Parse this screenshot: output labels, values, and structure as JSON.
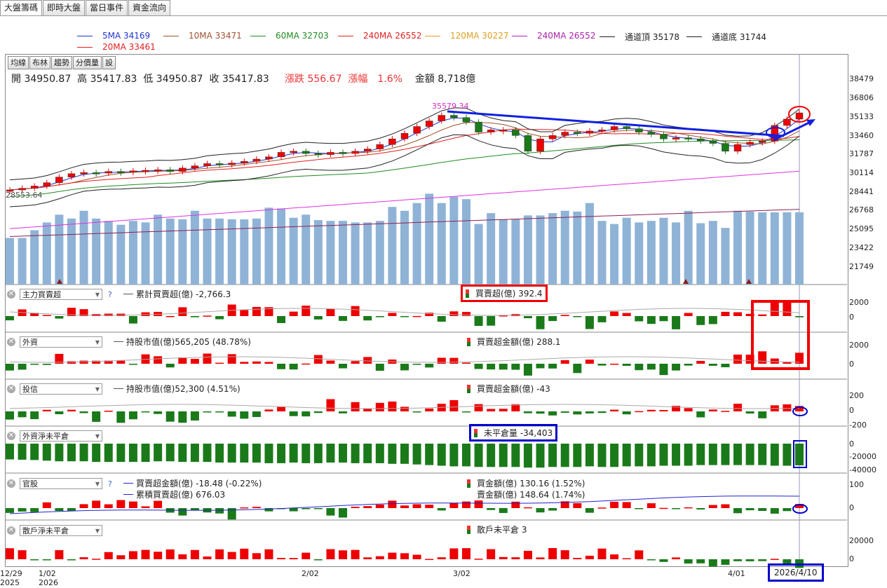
{
  "tabs": [
    "大盤籌碼",
    "即時大盤",
    "當日事件",
    "資金流向"
  ],
  "legend": [
    {
      "label": "5MA 34169",
      "color": "#2233cc"
    },
    {
      "label": "10MA 33471",
      "color": "#a0522d"
    },
    {
      "label": "60MA 32703",
      "color": "#228b22"
    },
    {
      "label": "240MA 26552",
      "color": "#e02020"
    },
    {
      "label": "120MA 30227",
      "color": "#e0a020"
    },
    {
      "label": "240MA 26552",
      "color": "#aa22aa"
    },
    {
      "label": "通道頂 35178",
      "color": "#222222"
    },
    {
      "label": "通道底 31744",
      "color": "#222222"
    },
    {
      "label": "20MA 33461",
      "color": "#e02020"
    }
  ],
  "toolbar": [
    "均線",
    "布林",
    "趨勢",
    "分價量",
    "設"
  ],
  "ohlc": {
    "open": "開 34950.87",
    "high": "高 35417.83",
    "low": "低 34950.87",
    "close": "收 35417.83",
    "change": "漲跌 556.67",
    "pct": "漲幅　1.6%",
    "amount": "金額 8,718億"
  },
  "price_axis": [
    "38479",
    "36806",
    "35133",
    "33460",
    "31787",
    "30114",
    "28441",
    "26768",
    "25095",
    "23422",
    "21749"
  ],
  "annotations": {
    "peak": "35579.34",
    "low_label": "28553.64"
  },
  "panels": [
    {
      "select": "主力買賣超",
      "help": "?",
      "line_label": "累計買賣超(億) -2,766.3",
      "bar_label": "買賣超(億) 392.4",
      "axis": [
        "2000",
        "0"
      ]
    },
    {
      "select": "外資",
      "line_label": "持股市值(億)565,205 (48.78%)",
      "bar_label": "買賣超金額(億) 288.1",
      "axis": [
        "2000",
        "0"
      ]
    },
    {
      "select": "投信",
      "line_label": "持股市值(億)52,300 (4.51%)",
      "bar_label": "買賣超金額(億) -43",
      "axis": [
        "200",
        "0",
        "-200"
      ]
    },
    {
      "select": "外資淨未平倉",
      "bar_label": "未平倉量 -34,403",
      "axis": [
        "0",
        "-20000",
        "-40000"
      ]
    },
    {
      "select": "官股",
      "help": "?",
      "line_label": "買賣超金額(億) -18.48 (-0.22%)",
      "line_label2": "累積買賣超(億) 676.03",
      "bar_label": "買金額(億) 130.16 (1.52%)",
      "bar_label2": "賣金額(億) 148.64 (1.74%)",
      "axis": [
        "100",
        "0"
      ]
    },
    {
      "select": "散戶淨未平倉",
      "bar_label": "散戶未平倉 3",
      "axis": [
        "20000",
        "0"
      ]
    }
  ],
  "xaxis": [
    {
      "label": "12/29",
      "sub": "2025"
    },
    {
      "label": "1/02",
      "sub": "2026"
    },
    {
      "label": "2/02",
      "sub": ""
    },
    {
      "label": "3/02",
      "sub": ""
    },
    {
      "label": "4/01",
      "sub": ""
    },
    {
      "label": "2026/4/10",
      "sub": ""
    }
  ],
  "chart_data": {
    "type": "candlestick",
    "ohlc_last": {
      "open": 34950.87,
      "high": 35417.83,
      "low": 34950.87,
      "close": 35417.83
    },
    "close": [
      28553,
      28700,
      28900,
      29200,
      29700,
      30000,
      30100,
      30050,
      30200,
      30150,
      30250,
      30300,
      30350,
      30200,
      30500,
      30700,
      30900,
      30800,
      30950,
      31100,
      31300,
      31500,
      31900,
      32000,
      31800,
      31700,
      31900,
      31800,
      32000,
      32200,
      32600,
      33100,
      33600,
      34200,
      34700,
      35200,
      35000,
      34600,
      33700,
      33900,
      33900,
      33400,
      32000,
      33100,
      33400,
      33700,
      33600,
      33800,
      33900,
      34200,
      34000,
      33700,
      33500,
      33100,
      33200,
      33100,
      32900,
      32700,
      32000,
      32600,
      32800,
      32900,
      34300,
      34861,
      35418
    ],
    "volume": [
      23000,
      23000,
      24000,
      25000,
      26000,
      25500,
      26500,
      25500,
      25200,
      24700,
      25200,
      25000,
      26000,
      25500,
      25400,
      26500,
      25500,
      25500,
      25400,
      25400,
      25500,
      26900,
      26800,
      25600,
      26000,
      25300,
      25200,
      25200,
      25000,
      25000,
      25200,
      27000,
      26500,
      27500,
      28700,
      27500,
      28300,
      28000,
      24800,
      26200,
      25400,
      25400,
      25900,
      25900,
      26200,
      26500,
      26400,
      27500,
      25200,
      24800,
      25600,
      25000,
      25200,
      25600,
      25000,
      26500,
      24900,
      25200,
      24300,
      26500,
      26400,
      26300,
      26300,
      26300,
      26300
    ],
    "foreign_oi": [
      -25000,
      -25500,
      -26000,
      -27000,
      -28000,
      -28000,
      -28000,
      -29000,
      -29000,
      -29000,
      -29000,
      -29000,
      -28000,
      -28000,
      -29000,
      -29000,
      -29000,
      -30000,
      -30000,
      -30000,
      -30000,
      -31000,
      -31000,
      -30000,
      -31000,
      -31000,
      -30000,
      -30000,
      -31000,
      -31000,
      -31000,
      -32000,
      -32000,
      -33000,
      -34000,
      -35000,
      -36000,
      -36000,
      -37000,
      -37000,
      -37000,
      -37000,
      -38000,
      -38000,
      -37000,
      -37000,
      -37000,
      -36000,
      -37000,
      -37000,
      -36000,
      -36000,
      -36000,
      -35000,
      -35000,
      -35000,
      -34000,
      -34000,
      -34000,
      -34000,
      -34000,
      -34000,
      -35000,
      -35000,
      -34403
    ]
  }
}
